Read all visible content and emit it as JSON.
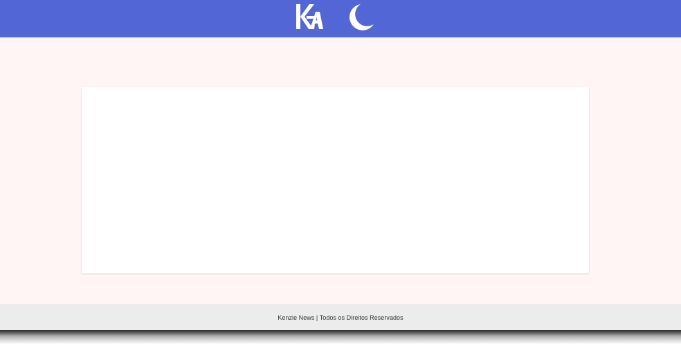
{
  "header": {
    "background_color": "#5267d5",
    "logo_icon": "kenzie-logo-icon",
    "theme_toggle_icon": "moon-icon"
  },
  "main": {
    "background_color": "#fff5f4",
    "content_card_background": "#ffffff"
  },
  "footer": {
    "text": "Kenzie News | Todos os Direitos Reservados",
    "background_color": "#ececec"
  }
}
